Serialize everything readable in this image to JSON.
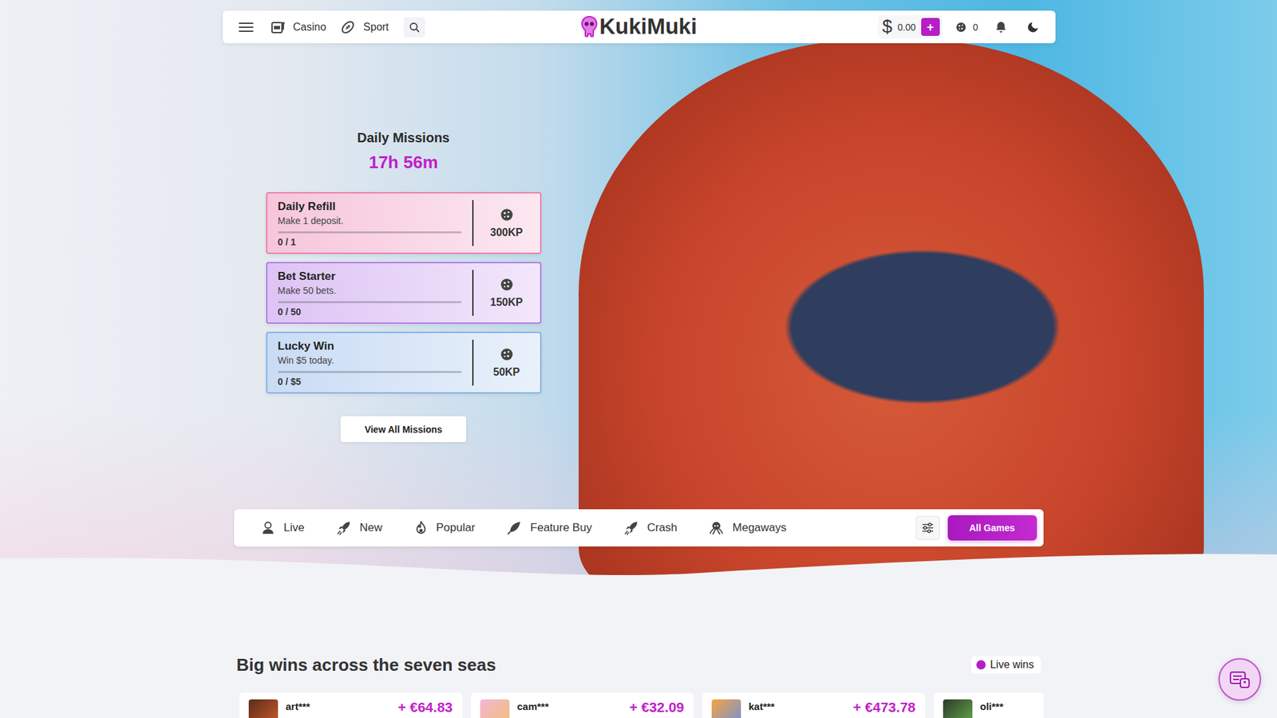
{
  "nav": {
    "links": [
      {
        "label": "Casino"
      },
      {
        "label": "Sport"
      }
    ],
    "logo": "KukiMuki",
    "balance": {
      "currency": "$",
      "amount": "0.00",
      "add": "+"
    },
    "points": "0"
  },
  "missions": {
    "title": "Daily Missions",
    "timer": "17h 56m",
    "items": [
      {
        "title": "Daily Refill",
        "description": "Make 1 deposit.",
        "progress": "0 / 1",
        "level": 0,
        "reward": "300KP",
        "color": "#ec7fae"
      },
      {
        "title": "Bet Starter",
        "description": "Make 50 bets.",
        "progress": "0 / 50",
        "level": 0,
        "reward": "150KP",
        "color": "#b47ae6"
      },
      {
        "title": "Lucky Win",
        "description": "Win $5 today.",
        "progress": "0 / $5",
        "level": 0,
        "reward": "50KP",
        "color": "#86b1e6"
      }
    ],
    "view_all": "View All Missions"
  },
  "categories": {
    "items": [
      {
        "label": "Live",
        "selected": false
      },
      {
        "label": "New",
        "selected": false
      },
      {
        "label": "Popular",
        "selected": false
      },
      {
        "label": "Feature Buy",
        "selected": false
      },
      {
        "label": "Crash",
        "selected": false
      },
      {
        "label": "Megaways",
        "selected": false
      }
    ],
    "all_games": {
      "label": "All Games",
      "selected": true
    }
  },
  "wins": {
    "title": "Big wins across the seven seas",
    "live_badge": "Live wins",
    "items": [
      {
        "user": "art***",
        "amount": "+ €64.83"
      },
      {
        "user": "cam***",
        "amount": "+ €32.09"
      },
      {
        "user": "kat***",
        "amount": "+ €473.78"
      },
      {
        "user": "oli***"
      }
    ]
  }
}
